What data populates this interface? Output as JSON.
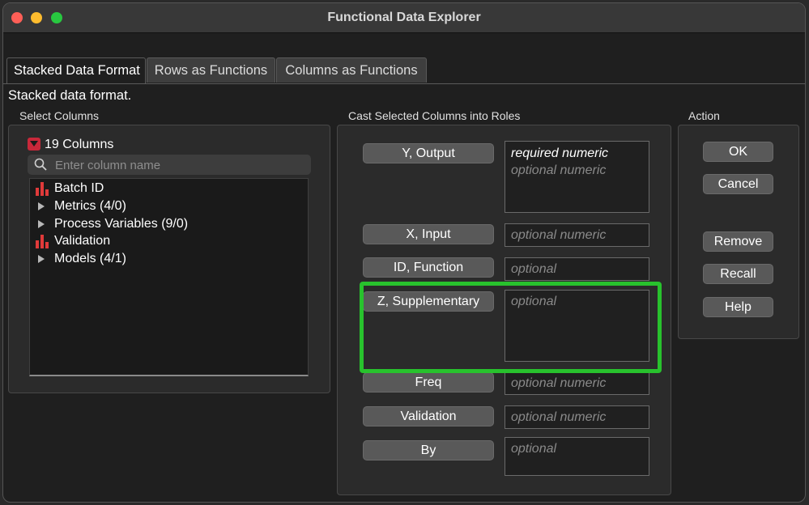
{
  "window": {
    "title": "Functional Data Explorer"
  },
  "tabs": [
    {
      "label": "Stacked Data Format",
      "active": true
    },
    {
      "label": "Rows as Functions",
      "active": false
    },
    {
      "label": "Columns as Functions",
      "active": false
    }
  ],
  "description": "Stacked data format.",
  "select_columns": {
    "heading": "Select Columns",
    "count_label": "19 Columns",
    "search_placeholder": "Enter column name",
    "items": [
      {
        "label": "Batch ID",
        "icon": "bar-chart-icon"
      },
      {
        "label": "Metrics (4/0)",
        "icon": "expand-arrow-icon"
      },
      {
        "label": "Process Variables (9/0)",
        "icon": "expand-arrow-icon"
      },
      {
        "label": "Validation",
        "icon": "bar-chart-icon"
      },
      {
        "label": "Models (4/1)",
        "icon": "expand-arrow-icon"
      }
    ]
  },
  "cast_roles": {
    "heading": "Cast Selected Columns into Roles",
    "roles": [
      {
        "button": "Y, Output",
        "values": [
          "required numeric",
          "optional numeric"
        ]
      },
      {
        "button": "X, Input",
        "values": [
          "optional numeric"
        ]
      },
      {
        "button": "ID, Function",
        "values": [
          "optional"
        ]
      },
      {
        "button": "Z, Supplementary",
        "values": [
          "optional"
        ]
      },
      {
        "button": "Freq",
        "values": [
          "optional numeric"
        ]
      },
      {
        "button": "Validation",
        "values": [
          "optional numeric"
        ]
      },
      {
        "button": "By",
        "values": [
          "optional"
        ]
      }
    ]
  },
  "action": {
    "heading": "Action",
    "buttons": [
      "OK",
      "Cancel",
      "Remove",
      "Recall",
      "Help"
    ]
  },
  "colors": {
    "highlight": "#28c22d",
    "accent_red": "#c8283a",
    "bar_icon": "#e03a3a"
  }
}
